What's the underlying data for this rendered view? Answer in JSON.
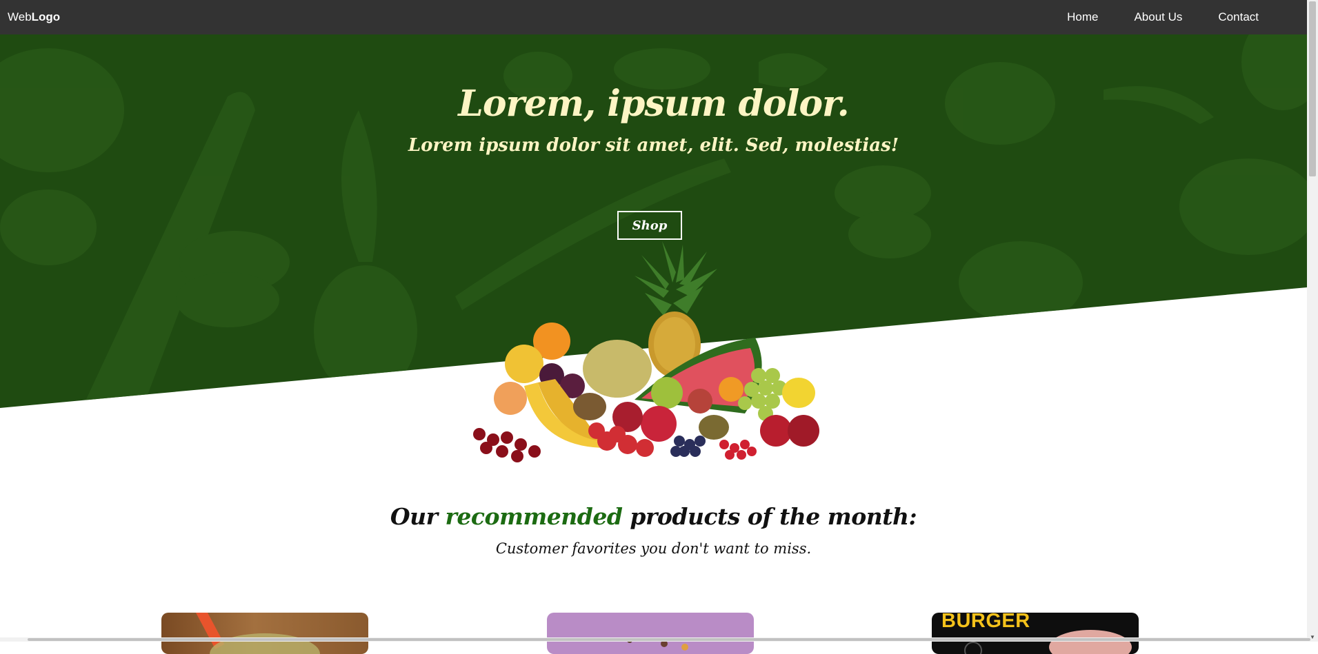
{
  "navbar": {
    "logo_prefix": "Web",
    "logo_bold": "Logo",
    "links": [
      {
        "label": "Home"
      },
      {
        "label": "About Us"
      },
      {
        "label": "Contact"
      }
    ]
  },
  "hero": {
    "title": "Lorem, ipsum dolor.",
    "subtitle": "Lorem ipsum dolor sit amet, elit. Sed, molestias!",
    "button_label": "Shop",
    "background_color": "#1f4b11",
    "text_color": "#fdf5c4"
  },
  "recommended": {
    "heading_before": "Our ",
    "heading_accent": "recommended",
    "heading_after": " products of the month:",
    "subheading": "Customer favorites you don't want to miss.",
    "accent_color": "#1c6b12",
    "cards": [
      {
        "label": ""
      },
      {
        "label": ""
      },
      {
        "label": "BURGER"
      }
    ]
  }
}
